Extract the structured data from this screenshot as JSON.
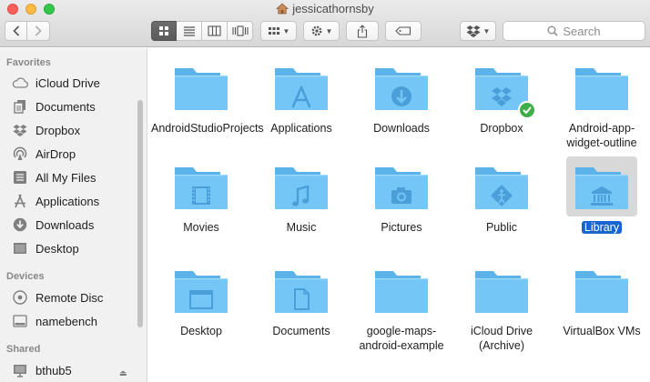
{
  "window": {
    "title": "jessicathornsby",
    "search_placeholder": "Search"
  },
  "sidebar": {
    "sections": [
      {
        "heading": "Favorites",
        "items": [
          {
            "label": "iCloud Drive",
            "icon": "cloud-icon"
          },
          {
            "label": "Documents",
            "icon": "documents-icon"
          },
          {
            "label": "Dropbox",
            "icon": "dropbox-icon"
          },
          {
            "label": "AirDrop",
            "icon": "airdrop-icon"
          },
          {
            "label": "All My Files",
            "icon": "all-files-icon"
          },
          {
            "label": "Applications",
            "icon": "applications-icon"
          },
          {
            "label": "Downloads",
            "icon": "downloads-icon"
          },
          {
            "label": "Desktop",
            "icon": "desktop-icon"
          }
        ]
      },
      {
        "heading": "Devices",
        "items": [
          {
            "label": "Remote Disc",
            "icon": "disc-icon"
          },
          {
            "label": "namebench",
            "icon": "drive-icon"
          }
        ]
      },
      {
        "heading": "Shared",
        "items": [
          {
            "label": "bthub5",
            "icon": "monitor-icon"
          }
        ]
      }
    ]
  },
  "files": [
    {
      "name": "AndroidStudioProjects",
      "glyph": "none"
    },
    {
      "name": "Applications",
      "glyph": "applications"
    },
    {
      "name": "Downloads",
      "glyph": "download"
    },
    {
      "name": "Dropbox",
      "glyph": "dropbox",
      "synced": true
    },
    {
      "name": "Android-app-widget-outline",
      "glyph": "none"
    },
    {
      "name": "Movies",
      "glyph": "film"
    },
    {
      "name": "Music",
      "glyph": "music"
    },
    {
      "name": "Pictures",
      "glyph": "camera"
    },
    {
      "name": "Public",
      "glyph": "public"
    },
    {
      "name": "Library",
      "glyph": "library",
      "selected": true
    },
    {
      "name": "Desktop",
      "glyph": "desktop"
    },
    {
      "name": "Documents",
      "glyph": "document"
    },
    {
      "name": "google-maps-android-example",
      "glyph": "none"
    },
    {
      "name": "iCloud Drive (Archive)",
      "glyph": "none"
    },
    {
      "name": "VirtualBox VMs",
      "glyph": "none"
    }
  ],
  "colors": {
    "folder_light": "#73c6f6",
    "folder_dark": "#5bb3ea",
    "selection": "#1865d2",
    "sync_badge": "#3fae49"
  }
}
